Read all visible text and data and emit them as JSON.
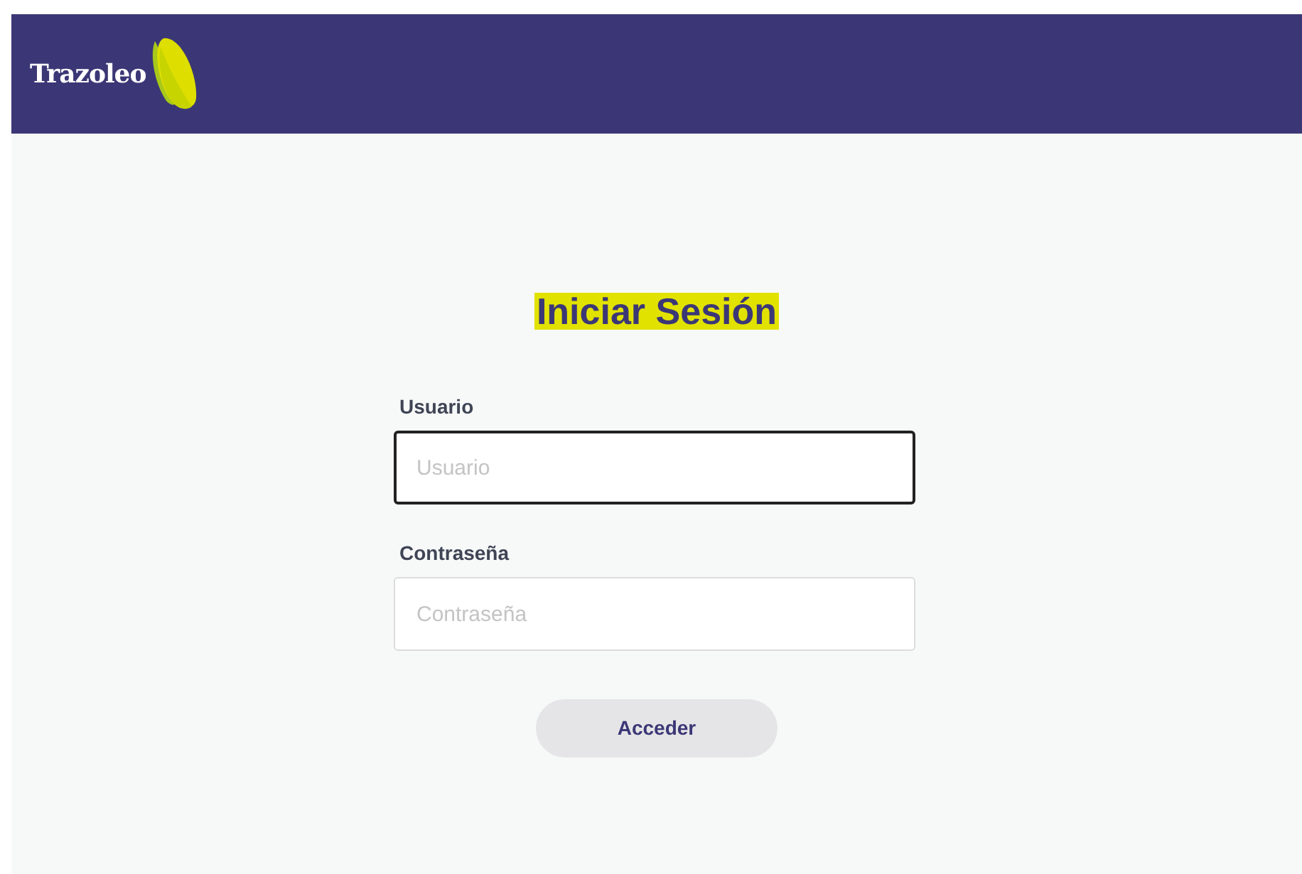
{
  "header": {
    "brand": "Trazoleo"
  },
  "title": "Iniciar Sesión",
  "fields": [
    {
      "label": "Usuario",
      "placeholder": "Usuario",
      "focused": true
    },
    {
      "label": "Contraseña",
      "placeholder": "Contraseña",
      "focused": false
    }
  ],
  "submit_button": "Acceder"
}
